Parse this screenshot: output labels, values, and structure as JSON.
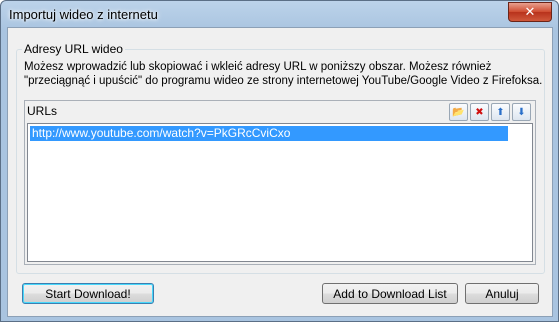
{
  "window": {
    "title": "Importuj wideo z internetu",
    "close_glyph": "✕"
  },
  "group": {
    "legend": "Adresy URL wideo",
    "description": "Możesz wprowadzić lub skopiować i wkleić adresy URL w poniższy obszar. Możesz również \"przeciągnąć i upuścić\" do programu wideo ze strony internetowej YouTube/Google Video z Firefoksa."
  },
  "urls": {
    "label": "URLs",
    "tools": [
      {
        "name": "open-folder-icon",
        "glyph": "📂"
      },
      {
        "name": "delete-icon",
        "glyph": "✖"
      },
      {
        "name": "move-up-icon",
        "glyph": "⬆"
      },
      {
        "name": "move-down-icon",
        "glyph": "⬇"
      }
    ],
    "items": [
      "http://www.youtube.com/watch?v=PkGRcCviCxo"
    ]
  },
  "buttons": {
    "start": "Start Download!",
    "add": "Add to Download List",
    "cancel": "Anuluj"
  },
  "colors": {
    "selection": "#3399ff",
    "close": "#c9452a"
  }
}
